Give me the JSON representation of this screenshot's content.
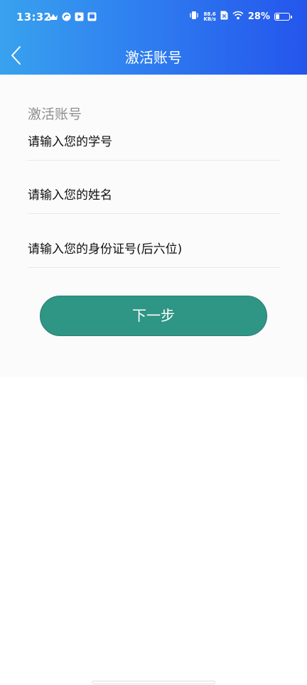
{
  "status_bar": {
    "time": "13:32",
    "left_icons": [
      "crown-icon",
      "app-swirl-icon",
      "video-play-icon",
      "app-box-icon"
    ],
    "net_speed_value": "88.6",
    "net_speed_unit": "KB/s",
    "battery_percent": "28%",
    "battery_level": 0.28
  },
  "nav": {
    "title": "激活账号",
    "back_icon": "chevron-left-icon"
  },
  "form": {
    "heading": "激活账号",
    "student_id_placeholder": "请输入您的学号",
    "name_placeholder": "请输入您的姓名",
    "id_card_placeholder": "请输入您的身份证号(后六位)",
    "next_label": "下一步"
  },
  "colors": {
    "header_gradient_start": "#38a2ee",
    "header_gradient_end": "#2455ec",
    "button": "#2f9584",
    "content_background": "#fbfbfb"
  }
}
